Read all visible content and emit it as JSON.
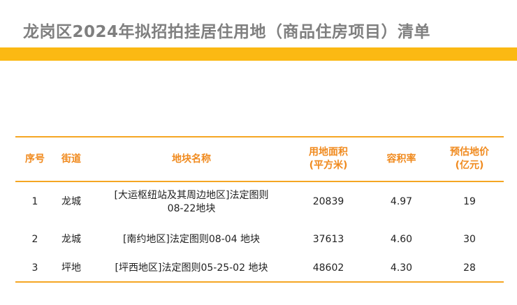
{
  "page": {
    "title": "龙岗区2024年拟招拍挂居住用地（商品住房项目）清单"
  },
  "theme": {
    "title_color": "#7f7f7f",
    "accent_bar": "#fbb913",
    "header_text": "#f08a1e",
    "rule_color": "#f5a623"
  },
  "table": {
    "headers": {
      "index": "序号",
      "street": "街道",
      "parcel_name": "地块名称",
      "area_line1": "用地面积",
      "area_line2": "(平方米)",
      "far": "容积率",
      "price_line1": "预估地价",
      "price_line2": "(亿元)"
    },
    "rows": [
      {
        "index": "1",
        "street": "龙城",
        "name_line1": "[大运枢纽站及其周边地区]法定图则",
        "name_line2": "08-22地块",
        "area": "20839",
        "far": "4.97",
        "price": "19"
      },
      {
        "index": "2",
        "street": "龙城",
        "name_line1": "[南约地区]法定图则08-04 地块",
        "name_line2": "",
        "area": "37613",
        "far": "4.60",
        "price": "30"
      },
      {
        "index": "3",
        "street": "坪地",
        "name_line1": "[坪西地区]法定图则05-25-02 地块",
        "name_line2": "",
        "area": "48602",
        "far": "4.30",
        "price": "28"
      }
    ]
  }
}
